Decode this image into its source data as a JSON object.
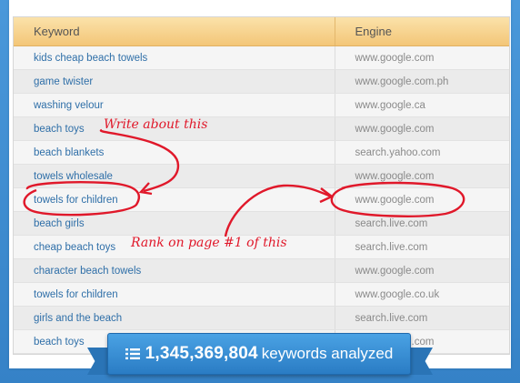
{
  "columns": {
    "keyword": "Keyword",
    "engine": "Engine"
  },
  "rows": [
    {
      "keyword": "kids cheap beach towels",
      "engine": "www.google.com"
    },
    {
      "keyword": "game twister",
      "engine": "www.google.com.ph"
    },
    {
      "keyword": "washing velour",
      "engine": "www.google.ca"
    },
    {
      "keyword": "beach toys",
      "engine": "www.google.com"
    },
    {
      "keyword": "beach blankets",
      "engine": "search.yahoo.com"
    },
    {
      "keyword": "towels wholesale",
      "engine": "www.google.com"
    },
    {
      "keyword": "towels for children",
      "engine": "www.google.com"
    },
    {
      "keyword": "beach girls",
      "engine": "search.live.com"
    },
    {
      "keyword": "cheap beach toys",
      "engine": "search.live.com"
    },
    {
      "keyword": "character beach towels",
      "engine": "www.google.com"
    },
    {
      "keyword": "towels for children",
      "engine": "www.google.co.uk"
    },
    {
      "keyword": "girls and the beach",
      "engine": "search.live.com"
    },
    {
      "keyword": "beach toys",
      "engine": "www.google.com"
    }
  ],
  "annotations": {
    "write_note": "Write about this",
    "rank_note": "Rank on page #1 of this"
  },
  "banner": {
    "icon": "list-icon",
    "count": "1,345,369,804",
    "label": "keywords analyzed"
  },
  "colors": {
    "background": "#3f8fd3",
    "header": "#f3c678",
    "link": "#2f6fa8",
    "annotation": "#e0182a",
    "banner": "#2a7cc4"
  }
}
